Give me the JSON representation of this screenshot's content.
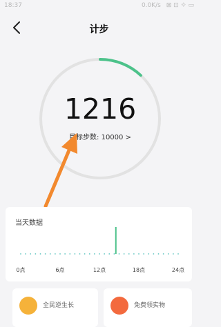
{
  "status": {
    "time": "18:37",
    "network": "0.0K/s",
    "indicators": "⊠ ⊡ ☼ ▭"
  },
  "nav": {
    "title": "计步",
    "back_icon": "chevron-left-icon"
  },
  "steps": {
    "value": "1216",
    "goal_label": "目标步数: 10000 >",
    "progress_fraction": 0.12
  },
  "daily": {
    "title": "当天数据",
    "x_ticks": [
      "0点",
      "6点",
      "12点",
      "18点",
      "24点"
    ]
  },
  "features": [
    {
      "label": "全民逆生长",
      "icon_color": "#f5b23a"
    },
    {
      "label": "免费领实物",
      "icon_color": "#f36a3e"
    }
  ],
  "colors": {
    "progress": "#4cc28a",
    "ring_track": "#e2e2e2",
    "bar": "#4cc28a",
    "arrow": "#f2892e",
    "dot": "#5fc5c0"
  },
  "chart_data": {
    "type": "bar",
    "title": "当天数据",
    "x_range": [
      0,
      24
    ],
    "x_ticks": [
      "0点",
      "6点",
      "12点",
      "18点",
      "24点"
    ],
    "bars": [
      {
        "hour": 14.5,
        "value": 1216
      }
    ]
  }
}
